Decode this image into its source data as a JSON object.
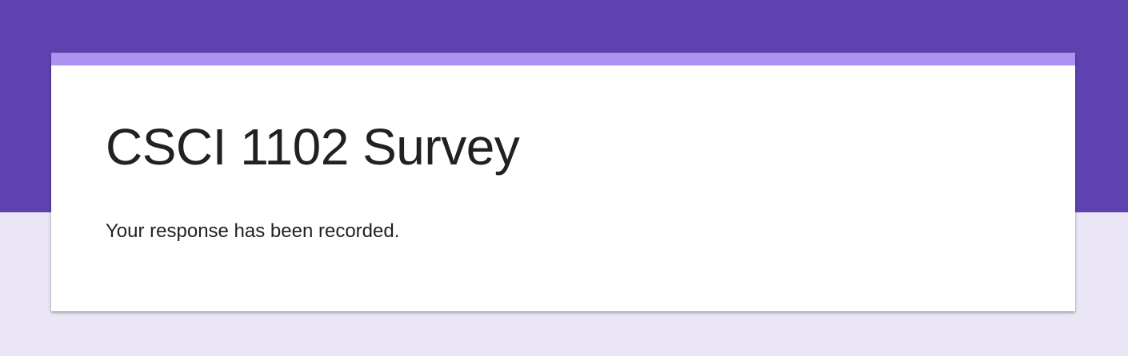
{
  "theme": {
    "header_color": "#5e43b0",
    "background_color": "#ebe6f5",
    "accent_color": "#ae92f2",
    "card_color": "#ffffff",
    "text_color": "#212121"
  },
  "form": {
    "title": "CSCI 1102 Survey",
    "confirmation_message": "Your response has been recorded."
  }
}
